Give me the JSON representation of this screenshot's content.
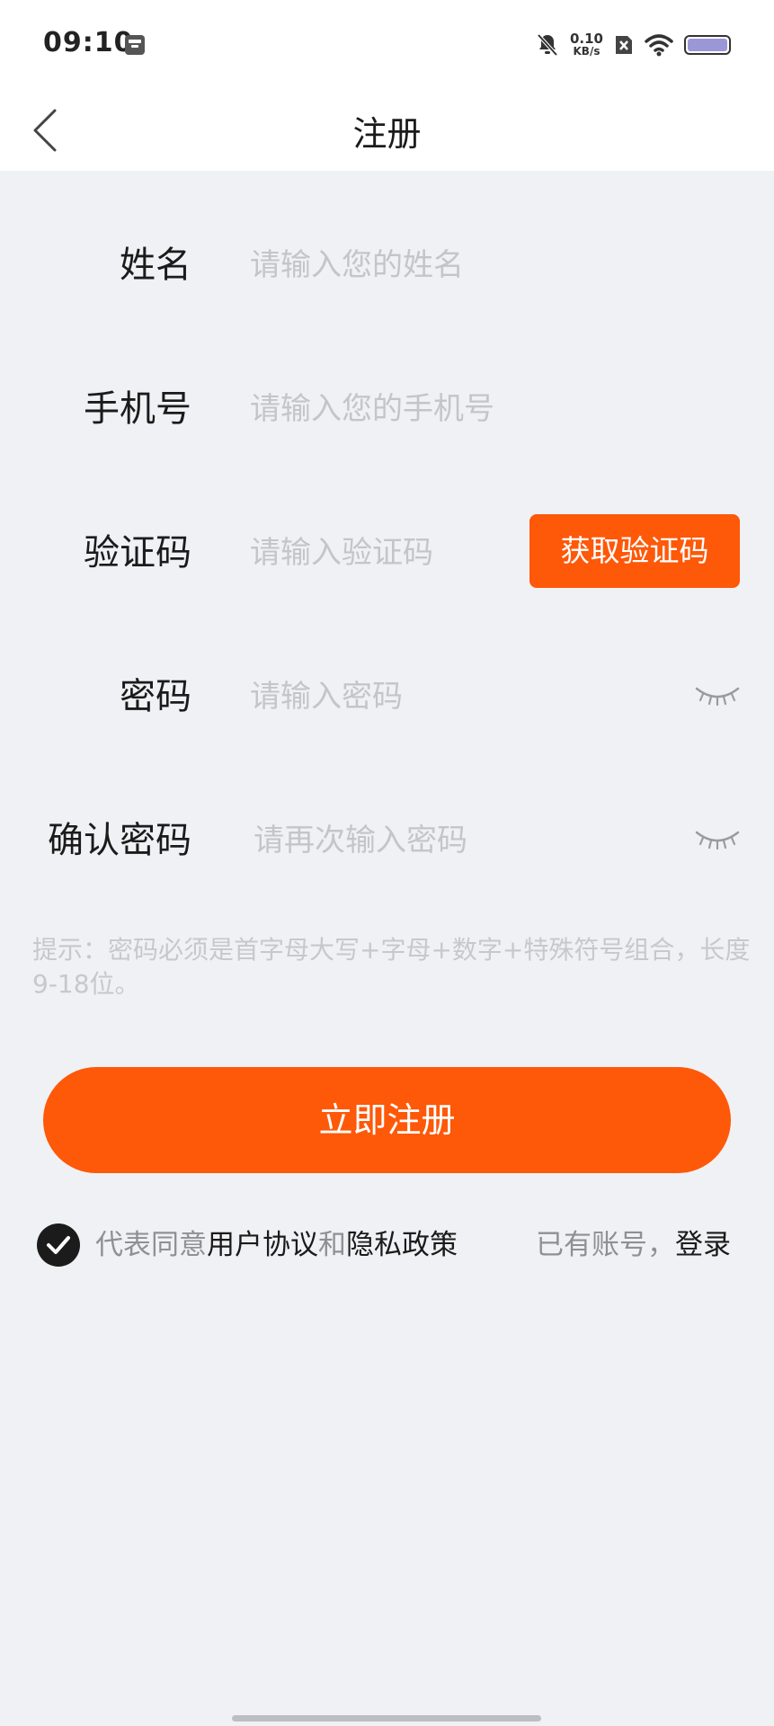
{
  "status_bar": {
    "time": "09:10",
    "net_speed_value": "0.10",
    "net_speed_unit": "KB/s"
  },
  "nav": {
    "title": "注册"
  },
  "form": {
    "name": {
      "label": "姓名",
      "placeholder": "请输入您的姓名"
    },
    "phone": {
      "label": "手机号",
      "placeholder": "请输入您的手机号"
    },
    "code": {
      "label": "验证码",
      "placeholder": "请输入验证码",
      "button": "获取验证码"
    },
    "password": {
      "label": "密码",
      "placeholder": "请输入密码"
    },
    "confirm_password": {
      "label": "确认密码",
      "placeholder": "请再次输入密码"
    }
  },
  "hint": "提示：密码必须是首字母大写+字母+数字+特殊符号组合，长度9-18位。",
  "register_button": "立即注册",
  "agreement": {
    "prefix": "代表同意",
    "user_agreement": "用户协议",
    "and": "和",
    "privacy_policy": "隐私政策",
    "checked": true
  },
  "login": {
    "prefix": "已有账号，",
    "link": "登录"
  },
  "colors": {
    "accent": "#fe5809",
    "background": "#f0f1f4",
    "placeholder": "#c4c5c9"
  }
}
